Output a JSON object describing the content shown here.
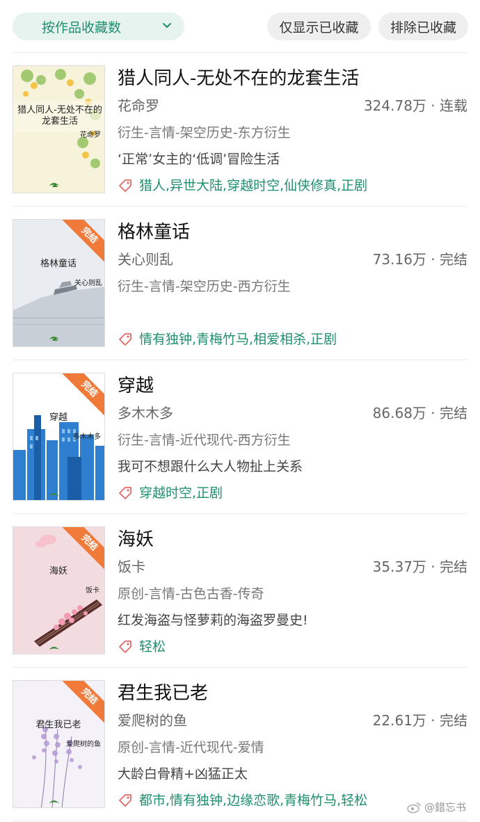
{
  "filter": {
    "sort_label": "按作品收藏数",
    "fav_only_label": "仅显示已收藏",
    "exclude_label": "排除已收藏"
  },
  "books": [
    {
      "title": "猎人同人-无处不在的龙套生活",
      "author": "花命罗",
      "stats": "324.78万 · 连载",
      "genre": "衍生-言情-架空历史-东方衍生",
      "desc": "‘正常’女主的‘低调’冒险生活",
      "tags": "猎人,异世大陆,穿越时空,仙侠修真,正剧",
      "cover_title": "猎人同人-无处不在的龙套生活",
      "cover_author": "花命罗",
      "completed": false
    },
    {
      "title": "格林童话",
      "author": "关心则乱",
      "stats": "73.16万 · 完结",
      "genre": "衍生-言情-架空历史-西方衍生",
      "desc": "",
      "tags": "情有独钟,青梅竹马,相爱相杀,正剧",
      "cover_title": "格林童话",
      "cover_author": "关心则乱",
      "completed": true
    },
    {
      "title": "穿越",
      "author": "多木木多",
      "stats": "86.68万 · 完结",
      "genre": "衍生-言情-近代现代-西方衍生",
      "desc": "我可不想跟什么大人物扯上关系",
      "tags": "穿越时空,正剧",
      "cover_title": "穿越",
      "cover_author": "多木木多",
      "completed": true
    },
    {
      "title": "海妖",
      "author": "饭卡",
      "stats": "35.37万 · 完结",
      "genre": "原创-言情-古色古香-传奇",
      "desc": "红发海盗与怪萝莉的海盗罗曼史!",
      "tags": "轻松",
      "cover_title": "海妖",
      "cover_author": "饭卡",
      "completed": true
    },
    {
      "title": "君生我已老",
      "author": "爱爬树的鱼",
      "stats": "22.61万 · 完结",
      "genre": "原创-言情-近代现代-爱情",
      "desc": "大龄白骨精+凶猛正太",
      "tags": "都市,情有独钟,边缘恋歌,青梅竹马,轻松",
      "cover_title": "君生我已老",
      "cover_author": "爱爬树的鱼",
      "completed": true
    }
  ],
  "ribbon_label": "完结",
  "watermark": "@錯忘书",
  "colors": {
    "accent": "#1f8f6d",
    "ribbon": "#f07a3a",
    "tag_icon": "#e06a6a"
  }
}
